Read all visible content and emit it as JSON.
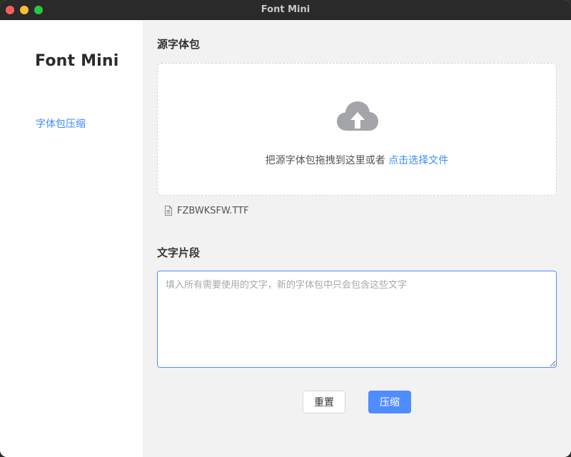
{
  "window": {
    "title": "Font Mini"
  },
  "sidebar": {
    "app_name": "Font Mini",
    "items": [
      {
        "label": "字体包压缩",
        "active": true
      }
    ]
  },
  "main": {
    "source_section": {
      "title": "源字体包",
      "dropzone_text": "把源字体包拖拽到这里或者",
      "dropzone_link": "点击选择文件",
      "icon": "cloud-upload-icon"
    },
    "file": {
      "icon": "document-icon",
      "name": "FZBWKSFW.TTF"
    },
    "text_section": {
      "title": "文字片段",
      "value": "",
      "placeholder": "填入所有需要使用的文字，新的字体包中只会包含这些文字"
    },
    "actions": {
      "reset_label": "重置",
      "compress_label": "压缩"
    }
  },
  "colors": {
    "accent": "#4f8dff",
    "link": "#3c8cff",
    "titlebar": "#2b2a2a",
    "sidebar_bg": "#ffffff",
    "main_bg": "#f2f2f2"
  }
}
